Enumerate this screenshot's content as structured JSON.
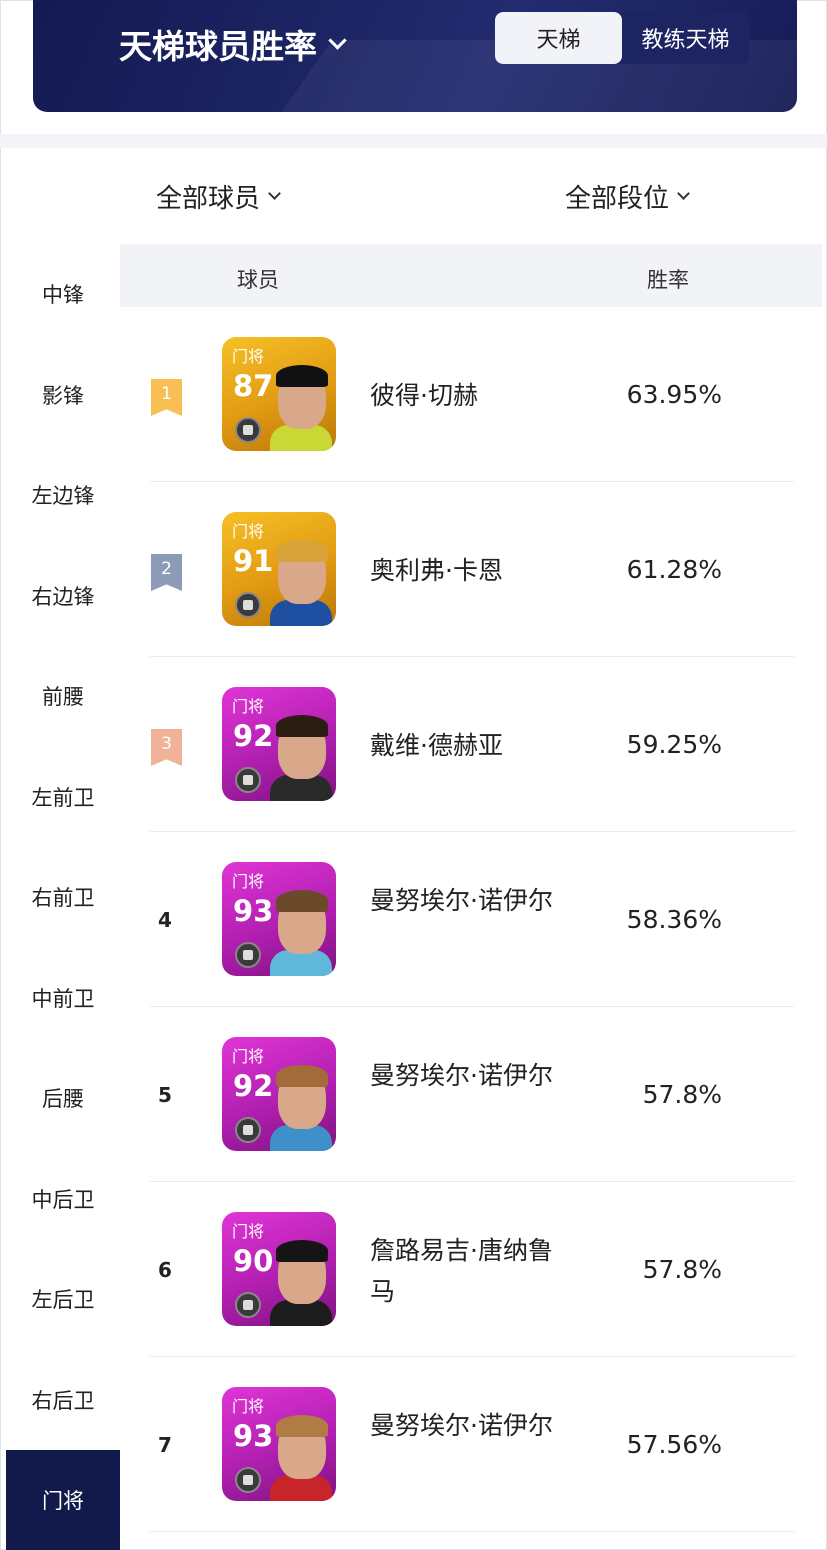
{
  "header": {
    "title": "天梯球员胜率",
    "tabs": [
      {
        "label": "天梯",
        "active": true
      },
      {
        "label": "教练天梯",
        "active": false
      }
    ]
  },
  "filters": {
    "players": "全部球员",
    "ranks": "全部段位"
  },
  "sidebar": {
    "items": [
      "中锋",
      "影锋",
      "左边锋",
      "右边锋",
      "前腰",
      "左前卫",
      "右前卫",
      "中前卫",
      "后腰",
      "中后卫",
      "左后卫",
      "右后卫",
      "门将"
    ],
    "active": "门将"
  },
  "table": {
    "columns": [
      "球员",
      "胜率"
    ],
    "rows": [
      {
        "rank": "1",
        "card_pos": "门将",
        "rating": "87",
        "name": "彼得·切赫",
        "rate": "63.95%",
        "card_color": "gold"
      },
      {
        "rank": "2",
        "card_pos": "门将",
        "rating": "91",
        "name": "奥利弗·卡恩",
        "rate": "61.28%",
        "card_color": "gold"
      },
      {
        "rank": "3",
        "card_pos": "门将",
        "rating": "92",
        "name": "戴维·德赫亚",
        "rate": "59.25%",
        "card_color": "purple"
      },
      {
        "rank": "4",
        "card_pos": "门将",
        "rating": "93",
        "name": "曼努埃尔·诺伊尔",
        "rate": "58.36%",
        "card_color": "purple"
      },
      {
        "rank": "5",
        "card_pos": "门将",
        "rating": "92",
        "name": "曼努埃尔·诺伊尔",
        "rate": "57.8%",
        "card_color": "purple"
      },
      {
        "rank": "6",
        "card_pos": "门将",
        "rating": "90",
        "name": "詹路易吉·唐纳鲁马",
        "rate": "57.8%",
        "card_color": "purple"
      },
      {
        "rank": "7",
        "card_pos": "门将",
        "rating": "93",
        "name": "曼努埃尔·诺伊尔",
        "rate": "57.56%",
        "card_color": "purple"
      }
    ]
  },
  "colors": {
    "banner": "#1e2667",
    "sidebar_active": "#121a4c",
    "rank1": "#f9bf55",
    "rank2": "#8d9ab8",
    "rank3": "#f1b29a",
    "gold_card": "#e29a12",
    "purple_card": "#b11fb0"
  }
}
